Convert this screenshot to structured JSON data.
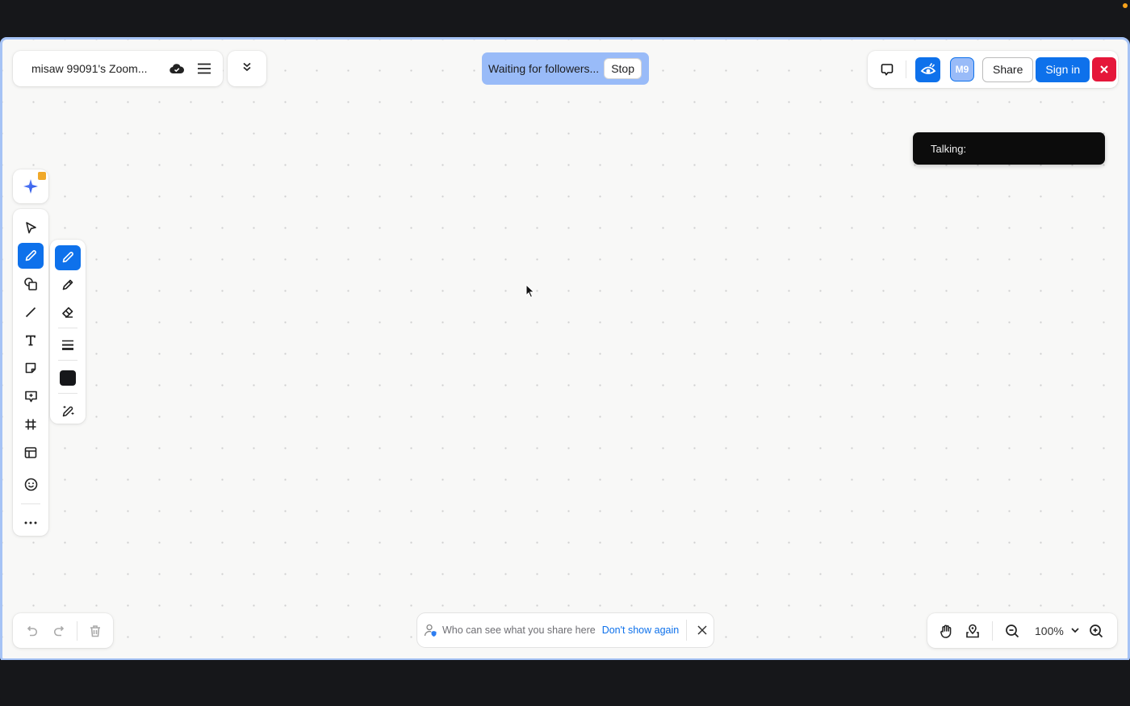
{
  "window": {
    "status_dot_color": "#f7a21b"
  },
  "header": {
    "title": "misaw 99091's Zoom...",
    "cloud_icon": "cloud-check-icon",
    "menu_icon": "hamburger-menu-icon",
    "collapse_icon": "double-chevron-down-icon"
  },
  "follow_banner": {
    "text": "Waiting for followers...",
    "stop_label": "Stop"
  },
  "top_right": {
    "chat_icon": "chat-bubble-icon",
    "follow_icon": "eye-follow-icon",
    "avatar_initials": "M9",
    "share_label": "Share",
    "signin_label": "Sign in",
    "close_icon": "close-icon"
  },
  "talking": {
    "label": "Talking:"
  },
  "toolbar": {
    "ai_icon": "ai-sparkle-icon",
    "tools": [
      {
        "name": "select",
        "icon": "pointer-icon",
        "active": false
      },
      {
        "name": "pen",
        "icon": "pen-icon",
        "active": true
      },
      {
        "name": "shapes",
        "icon": "shapes-icon",
        "active": false
      },
      {
        "name": "line",
        "icon": "line-icon",
        "active": false
      },
      {
        "name": "text",
        "icon": "text-icon",
        "active": false
      },
      {
        "name": "sticky-note",
        "icon": "sticky-note-icon",
        "active": false
      },
      {
        "name": "comment",
        "icon": "comment-icon",
        "active": false
      },
      {
        "name": "frame",
        "icon": "frame-icon",
        "active": false
      },
      {
        "name": "template",
        "icon": "template-icon",
        "active": false
      },
      {
        "name": "reactions",
        "icon": "emoji-icon",
        "active": false
      },
      {
        "name": "more",
        "icon": "more-icon",
        "active": false
      }
    ]
  },
  "pen_submenu": {
    "items": [
      {
        "name": "pen",
        "icon": "pen-icon",
        "active": true
      },
      {
        "name": "highlighter",
        "icon": "pencil-icon",
        "active": false
      },
      {
        "name": "eraser",
        "icon": "eraser-icon",
        "active": false
      },
      {
        "name": "stroke-width",
        "icon": "stroke-width-icon"
      },
      {
        "name": "color",
        "icon": "color-swatch",
        "color": "#16171a"
      },
      {
        "name": "magic-pen",
        "icon": "magic-pen-icon"
      }
    ]
  },
  "history": {
    "undo_icon": "undo-icon",
    "redo_icon": "redo-icon",
    "delete_icon": "trash-icon"
  },
  "notice": {
    "text": "Who can see what you share here",
    "link": "Don't show again",
    "close_icon": "close-icon"
  },
  "zoom_controls": {
    "hand_icon": "hand-icon",
    "locate_icon": "locate-icon",
    "zoom_out_icon": "zoom-out-icon",
    "zoom_value": "100%",
    "zoom_in_icon": "zoom-in-icon"
  },
  "colors": {
    "accent": "#0e71eb",
    "banner": "#99bbf8",
    "danger": "#e5173a",
    "frame_border": "#a6c3f5"
  }
}
